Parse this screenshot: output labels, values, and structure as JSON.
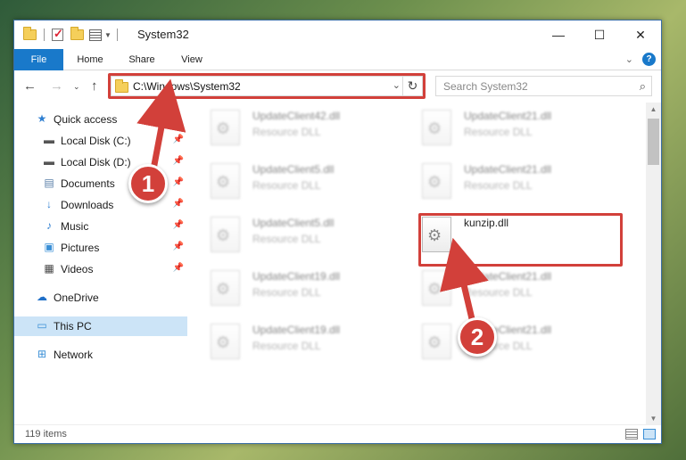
{
  "window": {
    "title": "System32",
    "controls": {
      "minimize": "—",
      "maximize": "☐",
      "close": "✕"
    }
  },
  "ribbon": {
    "tabs": [
      "File",
      "Home",
      "Share",
      "View"
    ],
    "help": "?"
  },
  "address_bar": {
    "path": "C:\\Windows\\System32"
  },
  "search": {
    "placeholder": "Search System32"
  },
  "nav_pane": {
    "items": [
      {
        "label": "Quick access",
        "icon": "star-icon",
        "pinned": false
      },
      {
        "label": "Local Disk (C:)",
        "icon": "drive-icon",
        "pinned": true
      },
      {
        "label": "Local Disk (D:)",
        "icon": "drive-icon",
        "pinned": true
      },
      {
        "label": "Documents",
        "icon": "documents-icon",
        "pinned": true
      },
      {
        "label": "Downloads",
        "icon": "download-icon",
        "pinned": true
      },
      {
        "label": "Music",
        "icon": "music-icon",
        "pinned": true
      },
      {
        "label": "Pictures",
        "icon": "pictures-icon",
        "pinned": true
      },
      {
        "label": "Videos",
        "icon": "videos-icon",
        "pinned": true
      },
      {
        "label": "OneDrive",
        "icon": "cloud-icon",
        "pinned": false
      },
      {
        "label": "This PC",
        "icon": "computer-icon",
        "pinned": false,
        "selected": true
      },
      {
        "label": "Network",
        "icon": "network-icon",
        "pinned": false
      }
    ]
  },
  "files": [
    {
      "name": "UpdateClient42.dll",
      "type": "Resource DLL",
      "blurred": true
    },
    {
      "name": "UpdateClient21.dll",
      "type": "Resource DLL",
      "blurred": true
    },
    {
      "name": "UpdateClient5.dll",
      "type": "Resource DLL",
      "blurred": true
    },
    {
      "name": "UpdateClient21.dll",
      "type": "Resource DLL",
      "blurred": true
    },
    {
      "name": "UpdateClient5.dll",
      "type": "Resource DLL",
      "blurred": true
    },
    {
      "name": "kunzip.dll",
      "type": "",
      "blurred": false,
      "highlighted": true
    },
    {
      "name": "UpdateClient19.dll",
      "type": "Resource DLL",
      "blurred": true
    },
    {
      "name": "UpdateClient21.dll",
      "type": "Resource DLL",
      "blurred": true
    },
    {
      "name": "UpdateClient19.dll",
      "type": "Resource DLL",
      "blurred": true
    },
    {
      "name": "UpdateClient21.dll",
      "type": "Resource DLL",
      "blurred": true
    }
  ],
  "status": {
    "item_count": "119 items"
  },
  "callouts": [
    "1",
    "2"
  ],
  "colors": {
    "accent": "#1979ca",
    "highlight": "#d2403a",
    "selected_nav": "#cce4f7"
  }
}
